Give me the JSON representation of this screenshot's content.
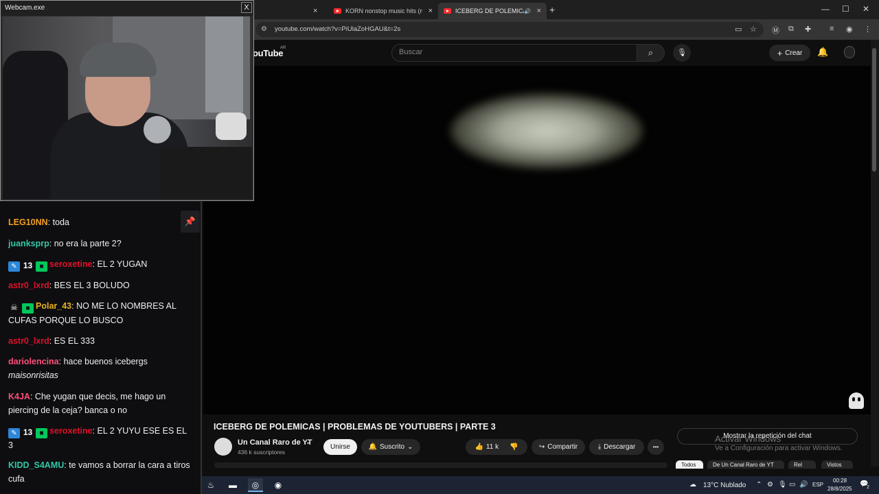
{
  "browser": {
    "tabs": [
      {
        "label": "KORN nonstop music hits (mix",
        "close": "×"
      },
      {
        "label": "ICEBERG DE POLEMICAS | P",
        "close": "×",
        "audio": "🔊"
      }
    ],
    "prev_tab_close": "×",
    "new_tab": "+",
    "window_controls": {
      "minimize": "—",
      "maximize": "☐",
      "close": "✕"
    },
    "url": "youtube.com/watch?v=PiUlaZoHGAU&t=2s"
  },
  "youtube": {
    "logo": "ouTube",
    "region": "AR",
    "search_placeholder": "Buscar",
    "create_label": "Crear"
  },
  "video": {
    "title": "ICEBERG DE POLEMICAS | PROBLEMAS DE YOUTUBERS | PARTE 3",
    "channel_name": "Un Canal Raro de YT",
    "subscribers": "436 k suscriptores",
    "join_label": "Unirse",
    "subscribed_label": "Suscrito",
    "likes": "11 k",
    "share_label": "Compartir",
    "download_label": "Descargar",
    "more": "•••",
    "live_chat_replay": "Mostrar la repetición del chat",
    "chips": [
      "Todos",
      "De Un Canal Raro de YT",
      "Rel",
      "Vistos"
    ]
  },
  "windows_watermark": {
    "title": "Activar Windows",
    "subtitle": "Ve a Configuración para activar Windows."
  },
  "webcam": {
    "title": "Webcam.exe",
    "close": "X"
  },
  "chat": {
    "messages": [
      {
        "user": "LEG10NN",
        "color": "#f0a020",
        "text": ": toda"
      },
      {
        "user": "juanksprp",
        "color": "#33c7a8",
        "text": ": no era la parte 2?"
      },
      {
        "user": "seroxetine",
        "color": "#e0102a",
        "text": ": EL 2 YUGAN",
        "badges": [
          "13"
        ]
      },
      {
        "user": "astr0_lxrd",
        "color": "#e0102a",
        "text": ": BES EL 3 BOLUDO"
      },
      {
        "user": "Polar_43",
        "color": "#e8b020",
        "text": ": NO ME LO NOMBRES AL CUFAS PORQUE LO BUSCO"
      },
      {
        "user": "astr0_lxrd",
        "color": "#e0102a",
        "text": ": ES EL 333"
      },
      {
        "user": "dariolencina",
        "color": "#ff4f7b",
        "text": ": hace buenos icebergs ",
        "emote": "maisonrisitas"
      },
      {
        "user": "K4JA",
        "color": "#ff4f7b",
        "text": ": Che yugan que decis, me hago un piercing de la ceja? banca o no"
      },
      {
        "user": "seroxetine",
        "color": "#e0102a",
        "text": ": EL 2 YUYU ESE ES EL 3",
        "badges": [
          "13"
        ]
      },
      {
        "user": "KIDD_S4AMU",
        "color": "#33c7a8",
        "text": ": te vamos a borrar la cara a tiros cufa"
      }
    ]
  },
  "taskbar": {
    "weather": "13°C  Nublado",
    "lang": "ESP",
    "time": "00:28",
    "date": "28/8/2025",
    "notifications": "2"
  },
  "colors": {
    "yt_bg": "#0f0f0f",
    "chat_bg": "#0e0e10",
    "taskbar": "#1c2433"
  }
}
